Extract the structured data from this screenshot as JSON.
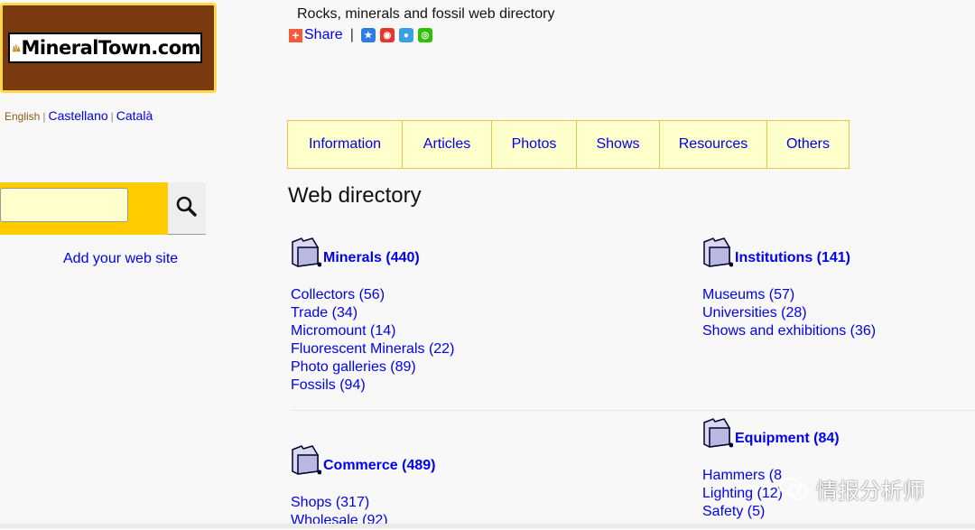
{
  "logo": {
    "text": "MineralTown.com"
  },
  "languages": [
    {
      "label": "English",
      "active": true
    },
    {
      "label": "Castellano",
      "active": false
    },
    {
      "label": "Català",
      "active": false
    }
  ],
  "search": {
    "placeholder": "",
    "button_icon": "search-icon"
  },
  "add_site": "Add your web site",
  "header": {
    "title": "Rocks, minerals and fossil web directory",
    "share_label": "Share",
    "separator": "|",
    "social_icons": [
      "qzone-icon",
      "weibo-icon",
      "tencent-weibo-icon",
      "wechat-icon"
    ]
  },
  "nav": {
    "tabs": [
      "Information",
      "Articles",
      "Photos",
      "Shows",
      "Resources",
      "Others"
    ]
  },
  "page": {
    "heading": "Web directory"
  },
  "categories": [
    {
      "title": "Minerals (440)",
      "items": [
        "Collectors (56)",
        "Trade (34)",
        "Micromount (14)",
        "Fluorescent Minerals (22)",
        "Photo galleries (89)",
        "Fossils (94)"
      ]
    },
    {
      "title": "Institutions (141)",
      "items": [
        "Museums (57)",
        "Universities (28)",
        "Shows and exhibitions (36)"
      ]
    },
    {
      "title": "Commerce (489)",
      "items": [
        "Shops (317)",
        "Wholesale (92)"
      ]
    },
    {
      "title": "Equipment (84)",
      "items": [
        "Hammers (8",
        "Lighting (12)",
        "Safety (5)"
      ]
    }
  ],
  "watermark": {
    "text": "情报分析师"
  },
  "colors": {
    "link": "#0000ee",
    "nav_bg": "#ffffcc",
    "search_bg": "#ffcc00",
    "logo_brown": "#7a3a10",
    "logo_border": "#ffd84a"
  }
}
